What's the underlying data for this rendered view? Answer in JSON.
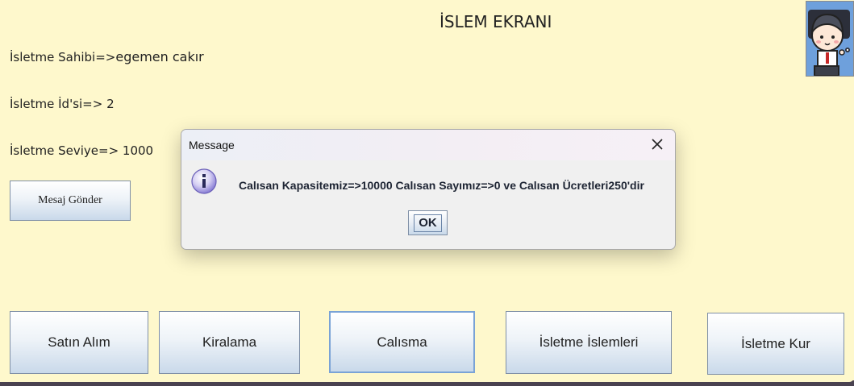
{
  "header": {
    "title": "İSLEM EKRANI"
  },
  "info": {
    "owner_label": "İsletme Sahibi=>",
    "owner_value": "egemen cakır",
    "id_text": "İsletme İd'si=> 2",
    "level_text": "İsletme Seviye=> 1000"
  },
  "avatar": {
    "icon": "character-avatar-icon",
    "background": "#6ea0dc"
  },
  "message_button": {
    "label": "Mesaj Gönder"
  },
  "bottom_buttons": {
    "buy": "Satın Alım",
    "rent": "Kiralama",
    "work": "Calısma",
    "business_ops": "İsletme İslemleri",
    "found": "İsletme Kur"
  },
  "dialog": {
    "title": "Message",
    "icon": "info-icon",
    "message": "Calısan Kapasitemiz=>10000 Calısan Sayımız=>0 ve Calısan Ücretleri250'dir",
    "ok_label": "OK"
  },
  "colors": {
    "background": "#fef8cc",
    "button_gradient_bottom": "#c9d9ea",
    "info_icon": "#8a7fd6"
  }
}
